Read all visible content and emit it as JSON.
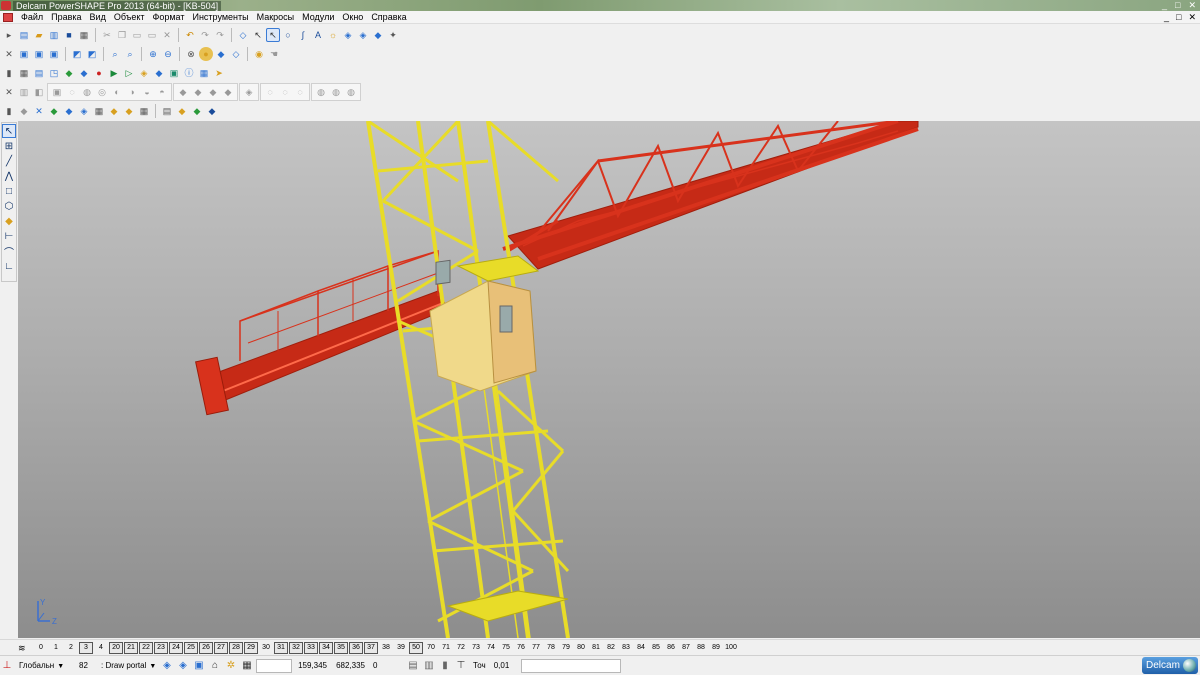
{
  "window": {
    "title": "Delcam PowerSHAPE Pro 2013 (64-bit) - [KB-504]",
    "controls": [
      "_",
      "□",
      "✕"
    ]
  },
  "menu": {
    "items": [
      "Файл",
      "Правка",
      "Вид",
      "Объект",
      "Формат",
      "Инструменты",
      "Макросы",
      "Модули",
      "Окно",
      "Справка"
    ],
    "mdi_controls": [
      "_",
      "□",
      "✕"
    ]
  },
  "levels": {
    "items": [
      {
        "label": "0",
        "used": false
      },
      {
        "label": "1",
        "used": false
      },
      {
        "label": "2",
        "used": false
      },
      {
        "label": "3",
        "used": true
      },
      {
        "label": "4",
        "used": false
      },
      {
        "label": "20",
        "used": true
      },
      {
        "label": "21",
        "used": true
      },
      {
        "label": "22",
        "used": true
      },
      {
        "label": "23",
        "used": true
      },
      {
        "label": "24",
        "used": true
      },
      {
        "label": "25",
        "used": true
      },
      {
        "label": "26",
        "used": true
      },
      {
        "label": "27",
        "used": true
      },
      {
        "label": "28",
        "used": true
      },
      {
        "label": "29",
        "used": true
      },
      {
        "label": "30",
        "used": false
      },
      {
        "label": "31",
        "used": true
      },
      {
        "label": "32",
        "used": true
      },
      {
        "label": "33",
        "used": true
      },
      {
        "label": "34",
        "used": true
      },
      {
        "label": "35",
        "used": true
      },
      {
        "label": "36",
        "used": true
      },
      {
        "label": "37",
        "used": true
      },
      {
        "label": "38",
        "used": false
      },
      {
        "label": "39",
        "used": false
      },
      {
        "label": "50",
        "used": true
      },
      {
        "label": "70",
        "used": false
      },
      {
        "label": "71",
        "used": false
      },
      {
        "label": "72",
        "used": false
      },
      {
        "label": "73",
        "used": false
      },
      {
        "label": "74",
        "used": false
      },
      {
        "label": "75",
        "used": false
      },
      {
        "label": "76",
        "used": false
      },
      {
        "label": "77",
        "used": false
      },
      {
        "label": "78",
        "used": false
      },
      {
        "label": "79",
        "used": false
      },
      {
        "label": "80",
        "used": false
      },
      {
        "label": "81",
        "used": false
      },
      {
        "label": "82",
        "used": false
      },
      {
        "label": "83",
        "used": false
      },
      {
        "label": "84",
        "used": false
      },
      {
        "label": "85",
        "used": false
      },
      {
        "label": "86",
        "used": false
      },
      {
        "label": "87",
        "used": false
      },
      {
        "label": "88",
        "used": false
      },
      {
        "label": "89",
        "used": false
      },
      {
        "label": "100",
        "used": false
      }
    ]
  },
  "status": {
    "workplane": "Глобальн",
    "level_num": "82",
    "level_name": ": Draw portal",
    "coord_x": "159,345",
    "coord_y": "682,335",
    "coord_z": "0",
    "tolerance_label": "Точ",
    "tolerance_value": "0,01",
    "brand": "Delcam"
  },
  "triad": {
    "y": "Y",
    "z": "Z"
  },
  "colors": {
    "boom": "#d8321c",
    "tower": "#e8dc28",
    "cab": "#f0d98a"
  }
}
